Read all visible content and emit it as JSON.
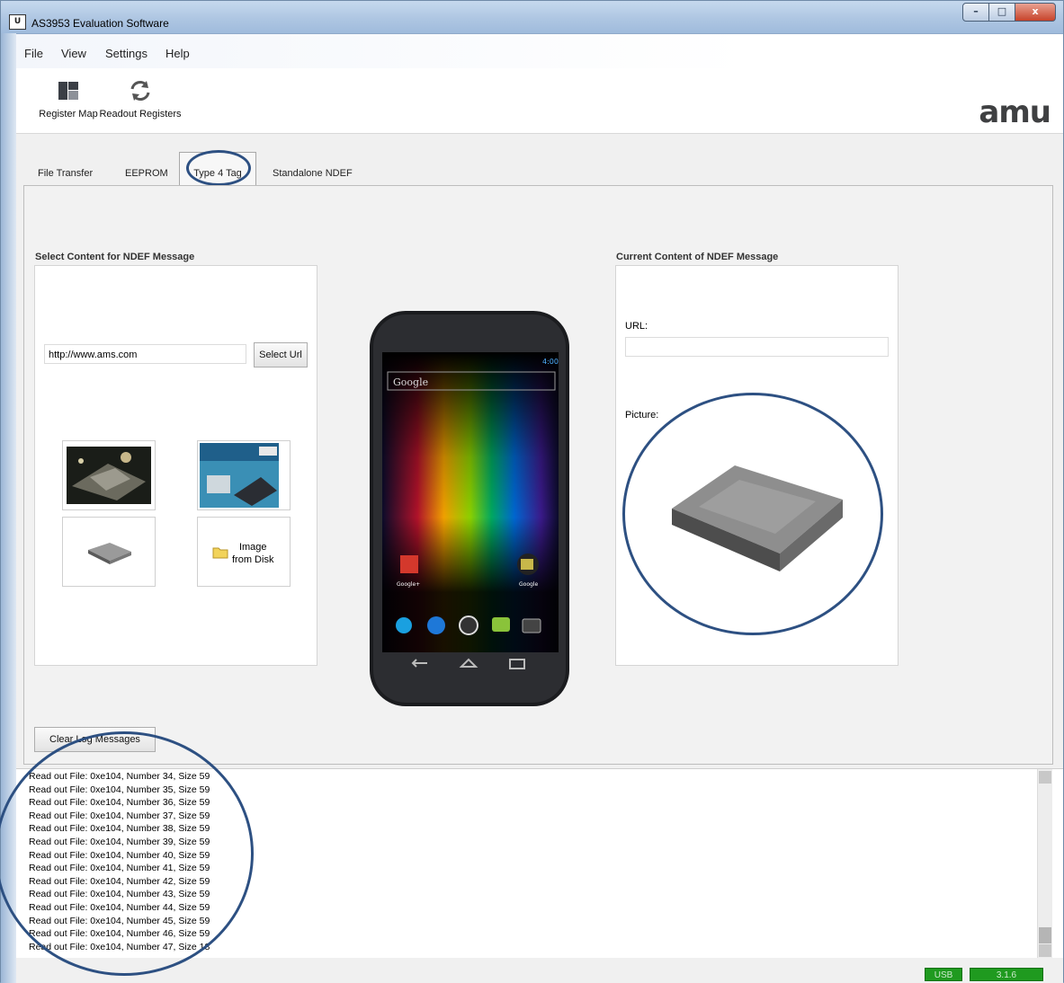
{
  "window": {
    "title": "AS3953 Evaluation Software",
    "app_icon_text": "U",
    "minimize": "–",
    "maximize": "□",
    "close": "x"
  },
  "menu": {
    "items": [
      "File",
      "View",
      "Settings",
      "Help"
    ]
  },
  "toolbar": {
    "register_map_label": "Register Map",
    "readout_registers_label": "Readout Registers",
    "logo_text": "amu"
  },
  "tabs": [
    {
      "label": "File Transfer",
      "active": false
    },
    {
      "label": "EEPROM",
      "active": false
    },
    {
      "label": "Type 4 Tag",
      "active": true
    },
    {
      "label": "Standalone NDEF",
      "active": false
    }
  ],
  "select_content": {
    "title": "Select Content for NDEF Message",
    "url_value": "http://www.ams.com",
    "select_url_button": "Select Url",
    "image_from_disk_label_line1": "Image",
    "image_from_disk_label_line2": "from Disk"
  },
  "phone": {
    "status_time": "4:00",
    "search_text": "Google",
    "app1_label": "Google+",
    "app2_label": "Google"
  },
  "current_content": {
    "title": "Current Content of NDEF Message",
    "url_label": "URL:",
    "url_value": "",
    "picture_label": "Picture:"
  },
  "clear_log_button": "Clear Log Messages",
  "log": [
    "Read out File: 0xe104, Number 34, Size 59",
    "Read out File: 0xe104, Number 35, Size 59",
    "Read out File: 0xe104, Number 36, Size 59",
    "Read out File: 0xe104, Number 37, Size 59",
    "Read out File: 0xe104, Number 38, Size 59",
    "Read out File: 0xe104, Number 39, Size 59",
    "Read out File: 0xe104, Number 40, Size 59",
    "Read out File: 0xe104, Number 41, Size 59",
    "Read out File: 0xe104, Number 42, Size 59",
    "Read out File: 0xe104, Number 43, Size 59",
    "Read out File: 0xe104, Number 44, Size 59",
    "Read out File: 0xe104, Number 45, Size 59",
    "Read out File: 0xe104, Number 46, Size 59",
    "Read out File: 0xe104, Number 47, Size 18"
  ],
  "status": {
    "connection": "USB",
    "version": "3.1.6"
  },
  "colors": {
    "status_green": "#1f9a1f",
    "annotation_ring": "#2d5082"
  }
}
